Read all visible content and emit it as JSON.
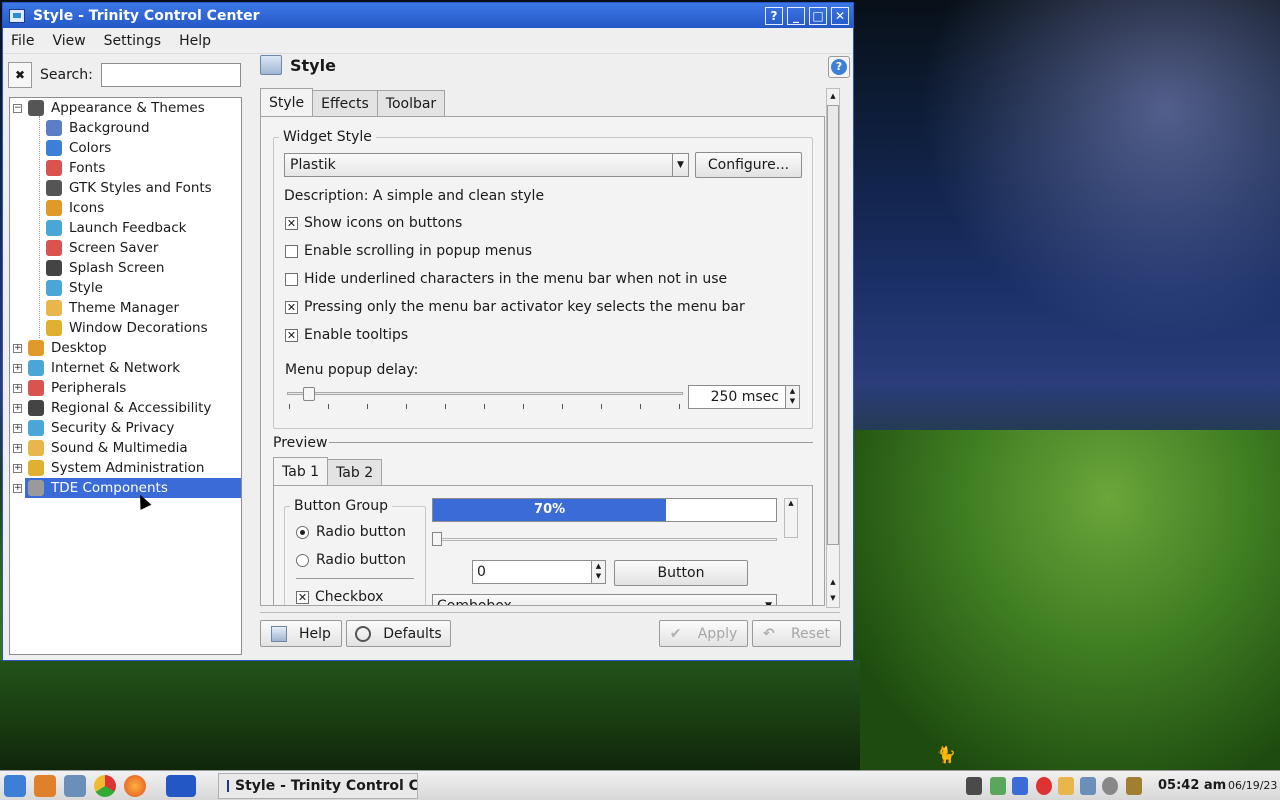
{
  "window": {
    "title": "Style - Trinity Control Center",
    "controls": [
      "?",
      "_",
      "□",
      "✕"
    ]
  },
  "menubar": [
    "File",
    "View",
    "Settings",
    "Help"
  ],
  "search": {
    "label": "Search:",
    "value": ""
  },
  "tree": {
    "groups": [
      {
        "label": "Appearance & Themes",
        "expanded": true,
        "icon": "appearance-icon",
        "children": [
          {
            "label": "Background",
            "icon": "background-icon"
          },
          {
            "label": "Colors",
            "icon": "colors-icon"
          },
          {
            "label": "Fonts",
            "icon": "fonts-icon"
          },
          {
            "label": "GTK Styles and Fonts",
            "icon": "gtk-icon"
          },
          {
            "label": "Icons",
            "icon": "icons-icon"
          },
          {
            "label": "Launch Feedback",
            "icon": "rocket-icon"
          },
          {
            "label": "Screen Saver",
            "icon": "screensaver-icon"
          },
          {
            "label": "Splash Screen",
            "icon": "splash-icon"
          },
          {
            "label": "Style",
            "icon": "style-icon"
          },
          {
            "label": "Theme Manager",
            "icon": "theme-icon"
          },
          {
            "label": "Window Decorations",
            "icon": "window-deco-icon"
          }
        ]
      },
      {
        "label": "Desktop",
        "icon": "desktop-icon"
      },
      {
        "label": "Internet & Network",
        "icon": "network-icon"
      },
      {
        "label": "Peripherals",
        "icon": "peripherals-icon"
      },
      {
        "label": "Regional & Accessibility",
        "icon": "regional-icon"
      },
      {
        "label": "Security & Privacy",
        "icon": "security-icon"
      },
      {
        "label": "Sound & Multimedia",
        "icon": "sound-icon"
      },
      {
        "label": "System Administration",
        "icon": "sysadmin-icon"
      },
      {
        "label": "TDE Components",
        "icon": "tde-icon",
        "selected": true
      }
    ]
  },
  "page": {
    "title": "Style"
  },
  "tabs": [
    "Style",
    "Effects",
    "Toolbar"
  ],
  "widget_style": {
    "group_title": "Widget Style",
    "selected": "Plastik",
    "configure_label": "Configure...",
    "description": "Description: A simple and clean style",
    "options": [
      {
        "label": "Show icons on buttons",
        "checked": true
      },
      {
        "label": "Enable scrolling in popup menus",
        "checked": false
      },
      {
        "label": "Hide underlined characters in the menu bar when not in use",
        "checked": false
      },
      {
        "label": "Pressing only the menu bar activator key selects the menu bar",
        "checked": true
      },
      {
        "label": "Enable tooltips",
        "checked": true
      }
    ],
    "delay_label": "Menu popup delay:",
    "delay_value": "250 msec",
    "delay_fraction": 0.06
  },
  "preview": {
    "title": "Preview",
    "tabs": [
      "Tab 1",
      "Tab 2"
    ],
    "button_group_title": "Button Group",
    "radio1": "Radio button",
    "radio2": "Radio button",
    "checkbox": "Checkbox",
    "progress_text": "70%",
    "progress": 0.7,
    "spin_value": "0",
    "button_label": "Button",
    "combo_value": "Combobox"
  },
  "buttons": {
    "help": "Help",
    "defaults": "Defaults",
    "apply": "Apply",
    "reset": "Reset"
  },
  "taskbar": {
    "task_label": "Style - Trinity Control C",
    "time": "05:42 am",
    "date": "06/19/23"
  },
  "colors": {
    "titlebar": "#2457c6",
    "selection": "#3a6bd6"
  }
}
